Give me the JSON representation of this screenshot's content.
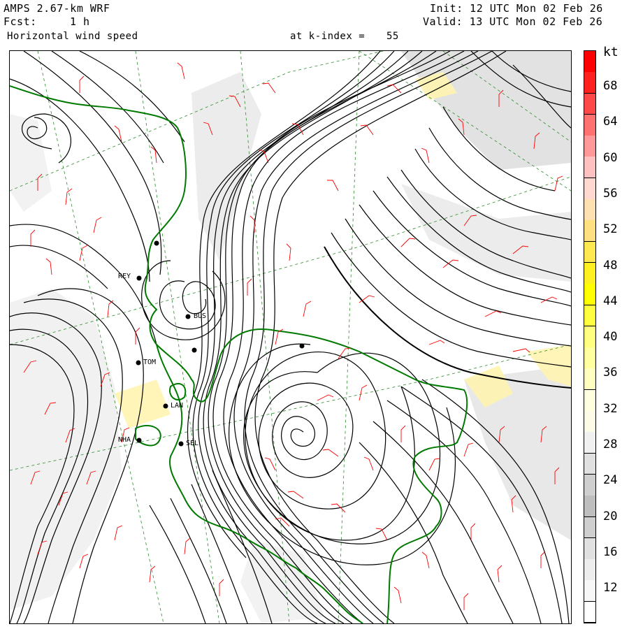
{
  "header": {
    "model": "AMPS 2.67-km WRF",
    "forecast_label": "Fcst:",
    "forecast_value": "1 h",
    "field": "Horizontal wind speed",
    "level_label": "at k-index =",
    "level_value": "55",
    "init": "Init: 12 UTC Mon 02 Feb 26",
    "valid": "Valid: 13 UTC Mon 02 Feb 26"
  },
  "colorbar": {
    "unit": "kt",
    "labels": [
      "68",
      "64",
      "60",
      "56",
      "52",
      "48",
      "44",
      "40",
      "36",
      "32",
      "28",
      "24",
      "20",
      "16",
      "12"
    ],
    "colors": [
      "#ff0000",
      "#ff2020",
      "#ff4848",
      "#ff7070",
      "#ff9898",
      "#ffc0c0",
      "#ffd8d0",
      "#ffe0b0",
      "#ffe080",
      "#ffe850",
      "#fff020",
      "#ffff00",
      "#ffff40",
      "#ffff80",
      "#ffffa0",
      "#ffffc0",
      "#ffffe0",
      "#fbfbe8",
      "#f0f0f0",
      "#e0e0e0",
      "#cfcfcf",
      "#bebebe",
      "#cfcfcf",
      "#e0e0e0",
      "#ededed",
      "#f7f7f7",
      "#ffffff"
    ]
  },
  "stations": [
    {
      "code": "REY"
    },
    {
      "code": "BUS"
    },
    {
      "code": "TOM"
    },
    {
      "code": "LAN"
    },
    {
      "code": "NHA"
    },
    {
      "code": "SEL"
    }
  ]
}
